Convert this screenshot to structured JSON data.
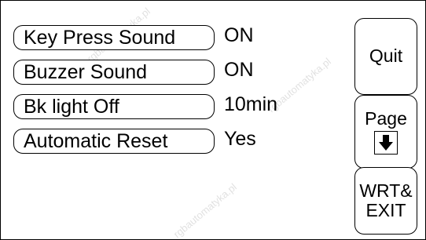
{
  "settings": [
    {
      "label": "Key Press Sound",
      "value": "ON"
    },
    {
      "label": "Buzzer Sound",
      "value": "ON"
    },
    {
      "label": "Bk light Off",
      "value": "10min"
    },
    {
      "label": "Automatic Reset",
      "value": "Yes"
    }
  ],
  "buttons": {
    "quit": "Quit",
    "page": "Page",
    "page_icon": "arrow-down-icon",
    "write_exit_line1": "WRT&",
    "write_exit_line2": "EXIT"
  },
  "watermark": "rgbautomatyka.pl"
}
